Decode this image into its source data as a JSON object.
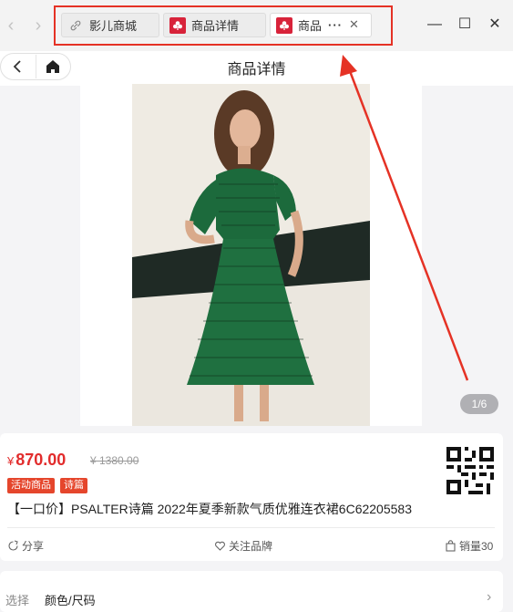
{
  "tabs": [
    {
      "label": "影儿商城",
      "icon": "link-icon"
    },
    {
      "label": "商品详情",
      "icon": "store-logo-icon"
    },
    {
      "label": "商品",
      "icon": "store-logo-icon"
    }
  ],
  "window": {
    "more": "···",
    "close_tab": "✕",
    "minimize": "—",
    "maximize": "☐",
    "close": "✕"
  },
  "header": {
    "title": "商品详情"
  },
  "gallery": {
    "counter": "1/6"
  },
  "product": {
    "currency": "¥",
    "price": "870.00",
    "original_price": "¥ 1380.00",
    "badges": [
      "活动商品",
      "诗篇"
    ],
    "title": "【一口价】PSALTER诗篇 2022年夏季新款气质优雅连衣裙6C62205583"
  },
  "actions": {
    "share": "分享",
    "follow": "关注品牌",
    "sales": "销量30"
  },
  "options": {
    "label": "选择",
    "value": "颜色/尺码"
  },
  "colors": {
    "accent": "#e22c2c",
    "badge": "#e5462c",
    "annotation": "#e53225"
  }
}
